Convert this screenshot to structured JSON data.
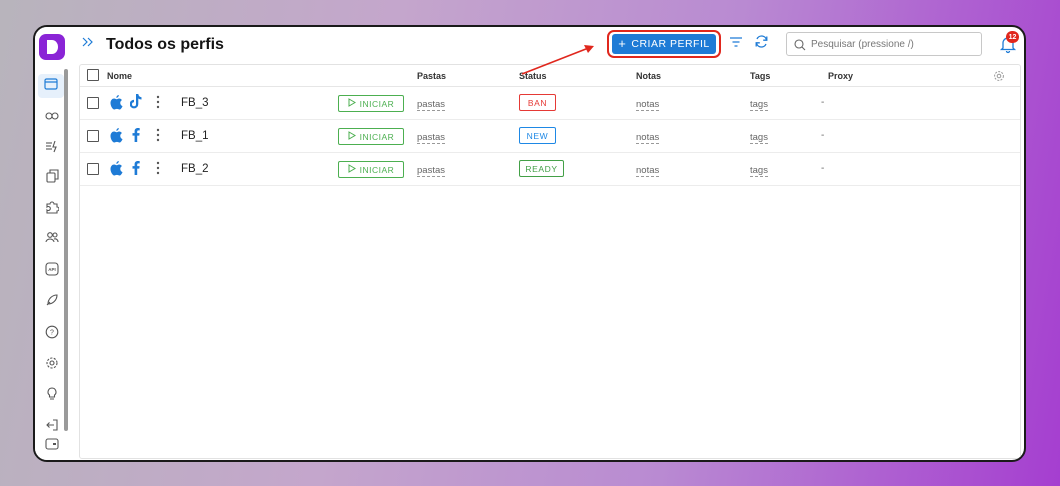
{
  "colors": {
    "accent": "#1e7bd6",
    "brand": "#8a24d6",
    "ban": "#e53935",
    "new": "#1e88e5",
    "ready": "#43a047",
    "highlight": "#e0271d"
  },
  "sidebar": {
    "items": [
      {
        "icon": "browser-window-icon",
        "active": true
      },
      {
        "icon": "link-icon"
      },
      {
        "icon": "automation-icon"
      },
      {
        "icon": "copy-icon"
      },
      {
        "icon": "puzzle-icon"
      },
      {
        "icon": "users-icon"
      },
      {
        "icon": "api-icon",
        "label": "API"
      },
      {
        "icon": "rocket-icon"
      },
      {
        "icon": "help-icon",
        "label": "?"
      },
      {
        "icon": "settings-icon"
      },
      {
        "icon": "lightbulb-icon"
      },
      {
        "icon": "logout-icon"
      },
      {
        "icon": "wallet-icon"
      }
    ]
  },
  "header": {
    "expand_icon": "double-chevron-right-icon",
    "title": "Todos os perfis",
    "create_label": "CRIAR PERFIL",
    "create_icon": "+",
    "search_placeholder": "Pesquisar (pressione /)",
    "notifications_count": "12"
  },
  "table": {
    "columns": {
      "name": "Nome",
      "folders": "Pastas",
      "status": "Status",
      "notes": "Notas",
      "tags": "Tags",
      "proxy": "Proxy"
    },
    "rows": [
      {
        "name": "FB_3",
        "os_icon": "apple-icon",
        "platform_icon": "tiktok-icon",
        "start": "INICIAR",
        "folders": "pastas",
        "status": "BAN",
        "status_color": "#e53935",
        "notes": "notas",
        "tags": "tags",
        "proxy": "-"
      },
      {
        "name": "FB_1",
        "os_icon": "apple-icon",
        "platform_icon": "facebook-icon",
        "start": "INICIAR",
        "folders": "pastas",
        "status": "NEW",
        "status_color": "#1e88e5",
        "notes": "notas",
        "tags": "tags",
        "proxy": "-"
      },
      {
        "name": "FB_2",
        "os_icon": "apple-icon",
        "platform_icon": "facebook-icon",
        "start": "INICIAR",
        "folders": "pastas",
        "status": "READY",
        "status_color": "#43a047",
        "notes": "notas",
        "tags": "tags",
        "proxy": "-"
      }
    ]
  }
}
